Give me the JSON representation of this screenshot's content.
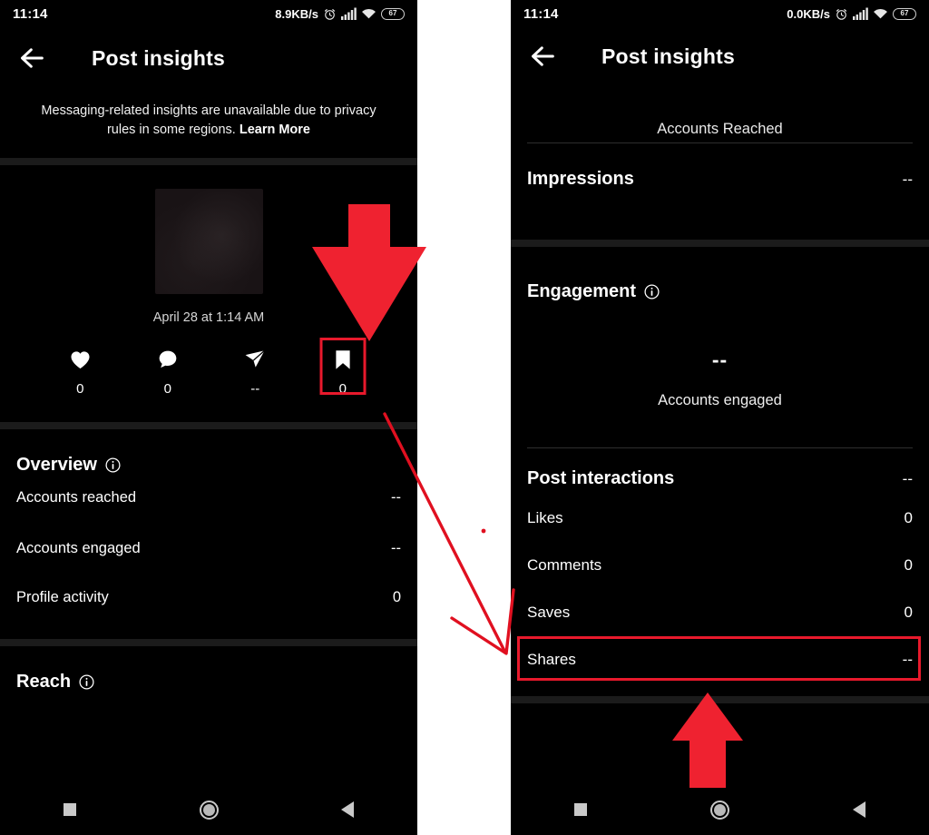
{
  "accent": {
    "highlight_red": "#e8192c",
    "arrow_red": "#ef2230",
    "screen_bg": "#000000",
    "gap_bg": "#ffffff"
  },
  "left_phone": {
    "statusbar": {
      "time": "11:14",
      "net_speed": "8.9KB/s",
      "alarm_icon": "alarm-clock-icon",
      "signal_icon": "signal-bars-icon",
      "wifi_icon": "wifi-icon",
      "battery_level": "67"
    },
    "header": {
      "back_icon": "back-arrow-icon",
      "title": "Post insights"
    },
    "notice": {
      "text": "Messaging-related insights are unavailable due to privacy rules in some regions. ",
      "link": "Learn More"
    },
    "post": {
      "thumbnail_name": "post-thumbnail",
      "date": "April 28 at 1:14 AM",
      "metrics": [
        {
          "icon": "heart-icon",
          "name": "likes",
          "value": "0"
        },
        {
          "icon": "comment-icon",
          "name": "comments",
          "value": "0"
        },
        {
          "icon": "share-icon",
          "name": "shares",
          "value": "--"
        },
        {
          "icon": "bookmark-icon",
          "name": "saves",
          "value": "0",
          "highlighted": true
        }
      ]
    },
    "overview": {
      "title": "Overview",
      "info_icon": "info-icon",
      "rows": [
        {
          "label": "Accounts reached",
          "value": "--"
        },
        {
          "label": "Accounts engaged",
          "value": "--"
        },
        {
          "label": "Profile activity",
          "value": "0"
        }
      ]
    },
    "reach": {
      "title": "Reach",
      "info_icon": "info-icon"
    },
    "navbar": {
      "recents_icon": "square-recents-icon",
      "home_icon": "circle-home-icon",
      "back_icon": "triangle-back-icon"
    }
  },
  "right_phone": {
    "statusbar": {
      "time": "11:14",
      "net_speed": "0.0KB/s",
      "alarm_icon": "alarm-clock-icon",
      "signal_icon": "signal-bars-icon",
      "wifi_icon": "wifi-icon",
      "battery_level": "67"
    },
    "header": {
      "back_icon": "back-arrow-icon",
      "title": "Post insights"
    },
    "clipped_label": "Accounts Reached",
    "impressions": {
      "label": "Impressions",
      "value": "--"
    },
    "engagement": {
      "title": "Engagement",
      "info_icon": "info-icon",
      "big_value": "--",
      "big_label": "Accounts engaged"
    },
    "post_interactions": {
      "label": "Post interactions",
      "value": "--",
      "rows": [
        {
          "label": "Likes",
          "value": "0"
        },
        {
          "label": "Comments",
          "value": "0"
        },
        {
          "label": "Saves",
          "value": "0",
          "highlighted": true
        },
        {
          "label": "Shares",
          "value": "--"
        }
      ]
    },
    "navbar": {
      "recents_icon": "square-recents-icon",
      "home_icon": "circle-home-icon",
      "back_icon": "triangle-back-icon"
    }
  },
  "annotations": {
    "down_arrow": "red-down-arrow-pointing-to-bookmark",
    "up_arrow": "red-up-arrow-pointing-to-saves-row",
    "connector": "red-diagonal-arrow-bookmark-to-saves",
    "dot": "red-dot-marker"
  }
}
